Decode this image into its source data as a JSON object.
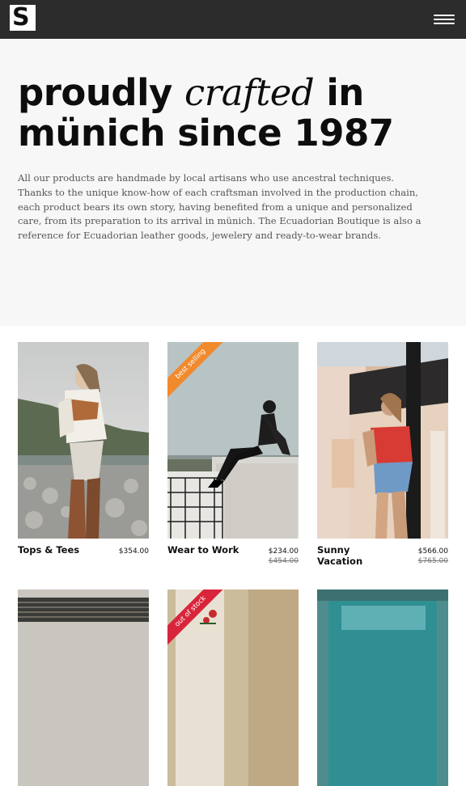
{
  "brand": {
    "logo_letter": "S"
  },
  "hero": {
    "headline_pre": "proudly ",
    "headline_em": "crafted",
    "headline_post": " in münich since 1987",
    "intro": "All our products are handmade by local artisans who use ancestral techniques. Thanks to the unique know-how of each craftsman involved in the production chain, each product bears its own story, having benefited from a unique and personalized care, from its preparation to its arrival in münich. The Ecuadorian Boutique is also a reference for Ecuadorian leather goods, jewelery and ready-to-wear brands."
  },
  "products": [
    {
      "name": "Tops & Tees",
      "price": "$354.00"
    },
    {
      "name": "Wear to Work",
      "price": "$234.00",
      "old_price": "$454.00",
      "badge": "best selling",
      "badge_color": "#f08a2c"
    },
    {
      "name": "Sunny Vacation",
      "price": "$566.00",
      "old_price": "$765.00"
    }
  ],
  "next_row": [
    {
      "badge": "out of stock",
      "badge_color": "#d9253b"
    }
  ],
  "colors": {
    "topbar": "#2c2c2c",
    "hero_bg": "#f7f7f7",
    "text": "#0d0d0d"
  }
}
